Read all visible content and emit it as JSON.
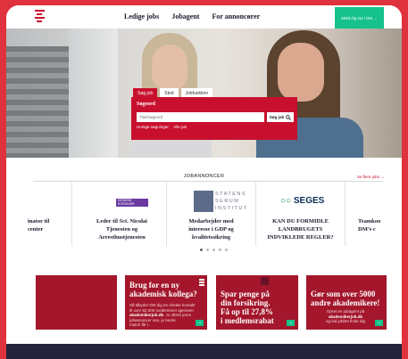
{
  "header": {
    "logo_text": "DM",
    "nav": [
      "Ledige jobs",
      "Jobagent",
      "For annoncører"
    ],
    "cta_label": "Meld dig ind i DM →"
  },
  "search": {
    "tabs": [
      "Søg job",
      "Sted",
      "Jobfunktion"
    ],
    "label": "Søgeord",
    "placeholder": "Titel/søgeord",
    "button": "Søg job",
    "quick_prefix": "Hurtige søgninger:",
    "quick_link": "Alle job"
  },
  "jobs": {
    "heading": "JOBANNONCER",
    "more_link": "Se flere jobs →",
    "cards": [
      {
        "title": "inator til\ncenter"
      },
      {
        "logo": "KIRKENS KORSHÆR",
        "title": "Leder til Sct. Nicolai\nTjenesten og\nArresthustjenesten"
      },
      {
        "logo": "STATENS\nSERUM\nINSTITUT",
        "title": "Medarbejder med\ninteresse i GDP og\nkvalitetssikring"
      },
      {
        "logo": "SEGES",
        "title": "KAN DU FORMIDLE\nLANDBRUGETS\nINDVIKLEDE REGLER?"
      },
      {
        "title": "Teamkoo\nDM’s c"
      }
    ]
  },
  "banners": [
    {
      "headline": "Brug for en ny\nakademisk kollega?",
      "body_pre": "Så tilbyder DM dig en direkte kontakt\ntil over 82.000 medlemmer igennem\n",
      "body_link": "akademikerjob.dk",
      "body_post": ". Jo oftere jeres\njobannoncer ses, jo bedre\nmatch får I."
    },
    {
      "headline": "Spar penge på\ndin forsikring.\nFå op til 27,8%\ni medlemsrabat"
    },
    {
      "headline": "Gør som over 5000\nandre akademikere!",
      "body_pre": "Opret en jobagent på\n",
      "body_link": "akademikerjob.dk",
      "body_post": "\nog lad jobbet finde dig"
    }
  ],
  "colors": {
    "brand_red": "#c8102e",
    "cta_green": "#14c28a",
    "navy": "#23243a"
  }
}
